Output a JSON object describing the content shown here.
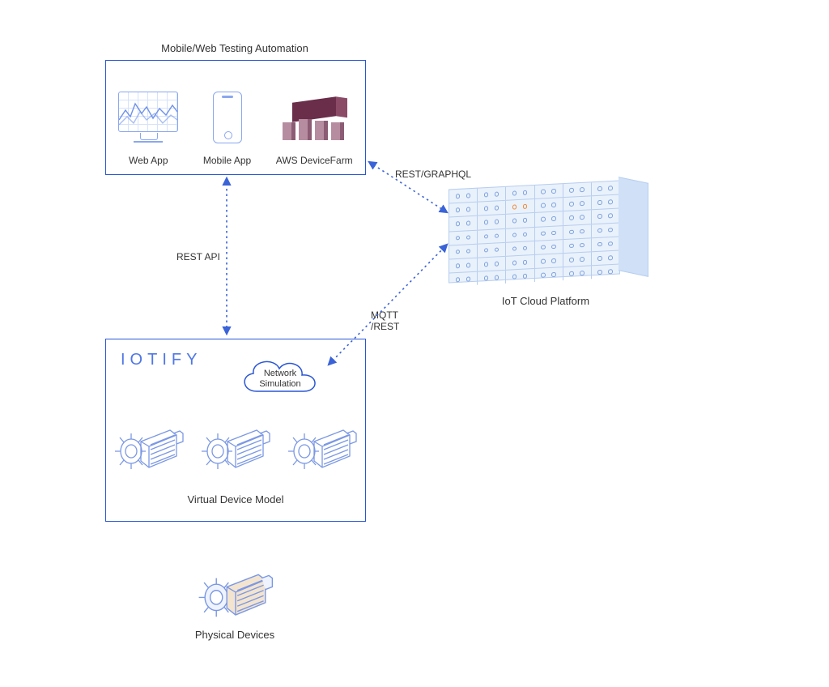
{
  "top": {
    "title": "Mobile/Web Testing Automation",
    "webapp_label": "Web App",
    "mobile_label": "Mobile App",
    "devicefarm_label": "AWS DeviceFarm"
  },
  "bottom": {
    "logo_text": "IOTIFY",
    "cloud_line1": "Network",
    "cloud_line2": "Simulation",
    "vdm_label": "Virtual Device Model"
  },
  "physical": {
    "label": "Physical Devices"
  },
  "server": {
    "label": "IoT Cloud Platform"
  },
  "connectors": {
    "top_to_server": "REST/GRAPHQL",
    "top_to_bottom": "REST API",
    "bottom_to_server_l1": "MQTT",
    "bottom_to_server_l2": "/REST"
  },
  "colors": {
    "box_border": "#2a56d6",
    "line_blue": "#3a63d8",
    "aws_dark": "#6a2d4a",
    "aws_light": "#b68ca0"
  }
}
